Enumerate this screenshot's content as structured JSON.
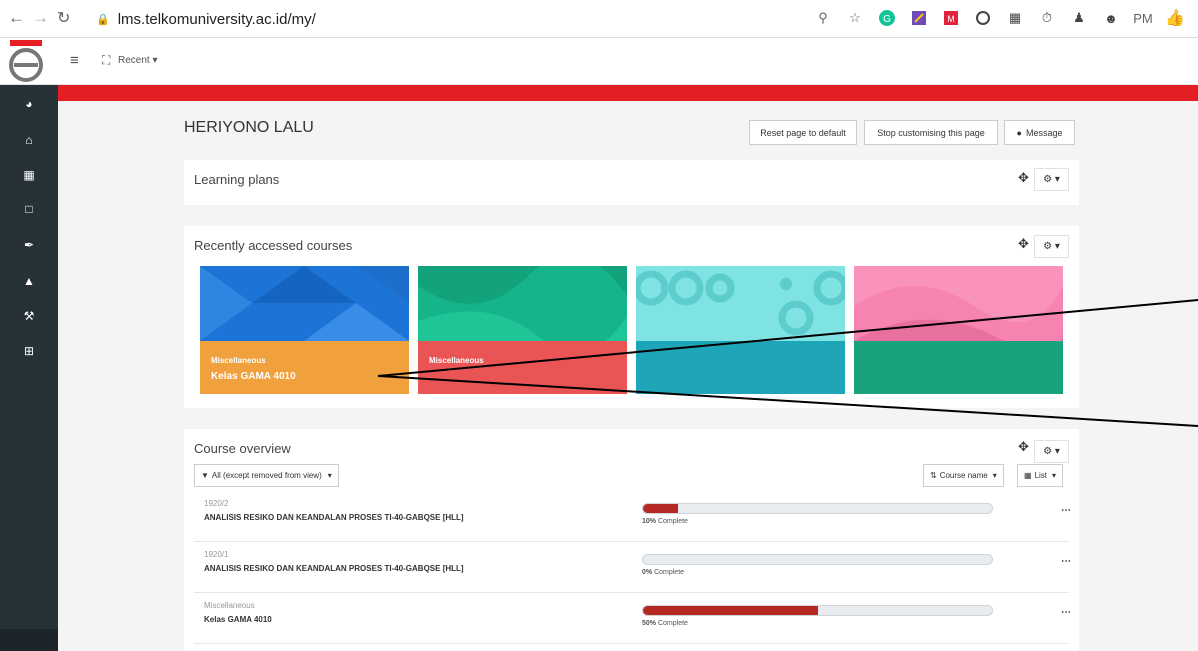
{
  "browser": {
    "url": "lms.telkomuniversity.ac.id/my/",
    "profile_initials": "PM"
  },
  "header": {
    "recent_label": "Recent"
  },
  "page": {
    "user_name": "HERIYONO LALU",
    "buttons": {
      "reset": "Reset page to default",
      "stop": "Stop customising this page",
      "message": "Message"
    }
  },
  "learning_plans": {
    "title": "Learning plans"
  },
  "recent_courses": {
    "title": "Recently accessed courses",
    "tiles": [
      {
        "category": "Miscellaneous",
        "name": "Kelas GAMA 4010",
        "img_color": "#1c74d6",
        "band_color": "#f0a03c"
      },
      {
        "category": "Miscellaneous",
        "name": "",
        "img_color": "#16b48a",
        "band_color": "#ea5455"
      },
      {
        "category": "",
        "name": "",
        "img_color": "#7fe3e3",
        "band_color": "#1fa5b8"
      },
      {
        "category": "",
        "name": "",
        "img_color": "#f783b0",
        "band_color": "#18a37e"
      }
    ]
  },
  "course_overview": {
    "title": "Course overview",
    "filter_label": "All (except removed from view)",
    "sort_label": "Course name",
    "view_label": "List",
    "complete_word": "Complete",
    "rows": [
      {
        "term": "1920/2",
        "name": "ANALISIS RESIKO DAN KEANDALAN PROSES TI-40-GABQSE [HLL]",
        "progress_pct": "10%",
        "progress": 10
      },
      {
        "term": "1920/1",
        "name": "ANALISIS RESIKO DAN KEANDALAN PROSES TI-40-GABQSE [HLL]",
        "progress_pct": "0%",
        "progress": 0
      },
      {
        "term": "Miscellaneous",
        "name": "Kelas GAMA 4010",
        "progress_pct": "50%",
        "progress": 50
      }
    ]
  },
  "colors": {
    "accent_red": "#e31e24",
    "sidebar": "#263238",
    "progress": "#b52a25"
  }
}
